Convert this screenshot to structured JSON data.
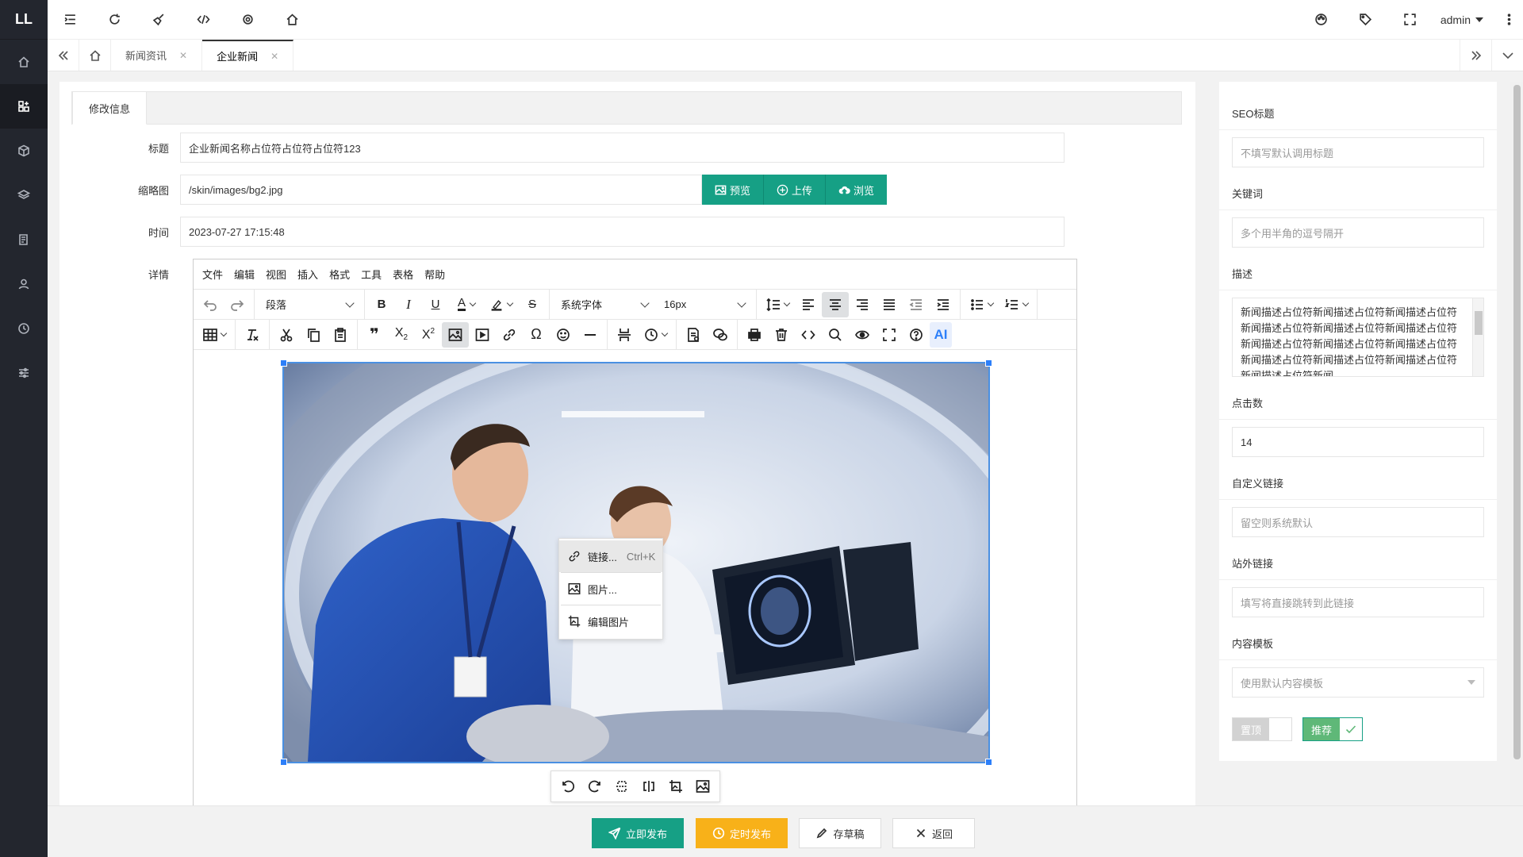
{
  "sidebar": {
    "logo": "LL",
    "items": [
      {
        "icon": "home-icon"
      },
      {
        "icon": "apps-icon"
      },
      {
        "icon": "cube-icon"
      },
      {
        "icon": "layers-icon"
      },
      {
        "icon": "book-icon"
      },
      {
        "icon": "user-icon"
      },
      {
        "icon": "clock-icon"
      },
      {
        "icon": "sliders-icon"
      }
    ]
  },
  "header": {
    "user": "admin"
  },
  "tabs": [
    {
      "label": "新闻资讯"
    },
    {
      "label": "企业新闻"
    }
  ],
  "form": {
    "tab_label": "修改信息",
    "title_label": "标题",
    "title_value": "企业新闻名称占位符占位符占位符123",
    "thumb_label": "缩略图",
    "thumb_value": "/skin/images/bg2.jpg",
    "btn_preview": "预览",
    "btn_upload": "上传",
    "btn_browse": "浏览",
    "time_label": "时间",
    "time_value": "2023-07-27 17:15:48",
    "detail_label": "详情"
  },
  "editor": {
    "menu": [
      "文件",
      "编辑",
      "视图",
      "插入",
      "格式",
      "工具",
      "表格",
      "帮助"
    ],
    "block_format": "段落",
    "font_family": "系统字体",
    "font_size": "16px",
    "ai_label": "AI",
    "context_menu": {
      "link": "链接...",
      "link_shortcut": "Ctrl+K",
      "image": "图片...",
      "edit_image": "编辑图片"
    }
  },
  "seo": {
    "seo_title_label": "SEO标题",
    "seo_title_placeholder": "不填写默认调用标题",
    "keywords_label": "关键词",
    "keywords_placeholder": "多个用半角的逗号隔开",
    "desc_label": "描述",
    "desc_value": "新闻描述占位符新闻描述占位符新闻描述占位符新闻描述占位符新闻描述占位符新闻描述占位符新闻描述占位符新闻描述占位符新闻描述占位符新闻描述占位符新闻描述占位符新闻描述占位符新闻描述占位符新闻",
    "clicks_label": "点击数",
    "clicks_value": "14",
    "custom_link_label": "自定义链接",
    "custom_link_placeholder": "留空则系统默认",
    "external_link_label": "站外链接",
    "external_link_placeholder": "填写将直接跳转到此链接",
    "template_label": "内容模板",
    "template_value": "使用默认内容模板",
    "top_label": "置顶",
    "recommend_label": "推荐"
  },
  "actions": {
    "publish": "立即发布",
    "schedule": "定时发布",
    "draft": "存草稿",
    "back": "返回"
  },
  "colors": {
    "primary": "#16a085",
    "warning": "#f8b119",
    "sidebar": "#23262e"
  }
}
